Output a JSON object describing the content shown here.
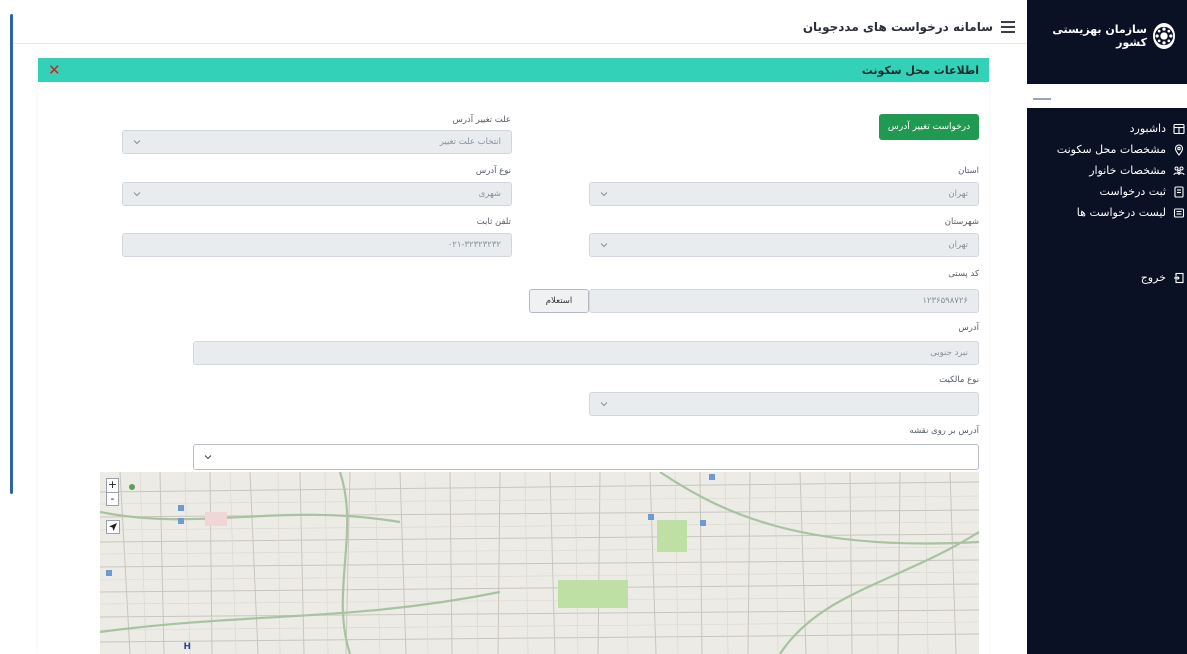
{
  "sidebar": {
    "brand": "سازمان بهزیستی کشور",
    "items": [
      {
        "label": "داشبورد",
        "icon": "dashboard-icon"
      },
      {
        "label": "مشخصات محل سکونت",
        "icon": "location-pin-icon"
      },
      {
        "label": "مشخصات خانوار",
        "icon": "family-icon"
      },
      {
        "label": "ثبت درخواست",
        "icon": "document-icon"
      },
      {
        "label": "لیست درخواست ها",
        "icon": "list-icon"
      }
    ],
    "logout": "خروج"
  },
  "header": {
    "title": "سامانه درخواست های مددجویان"
  },
  "panel": {
    "title": "اطلاعات محل سکونت",
    "close": "✕",
    "change_address_button": "درخواست تغییر آدرس",
    "change_reason": {
      "label": "علت تغییر آدرس",
      "placeholder": "انتخاب علت تغییر"
    },
    "province": {
      "label": "استان",
      "value": "تهران"
    },
    "address_type": {
      "label": "نوع آدرس",
      "value": "شهری"
    },
    "city": {
      "label": "شهرستان",
      "value": "تهران"
    },
    "landline": {
      "label": "تلفن ثابت",
      "value": "۰۲۱-۳۲۳۲۳۲۳۲"
    },
    "postal_code": {
      "label": "کد پستی",
      "value": "۱۲۳۶۵۹۸۷۲۶"
    },
    "inquiry_button": "استعلام",
    "address": {
      "label": "آدرس",
      "value": "نبرد جنوبی"
    },
    "ownership_type": {
      "label": "نوع مالکیت",
      "value": ""
    },
    "map_address": {
      "label": "آدرس بر روی نقشه",
      "value": ""
    }
  },
  "map": {
    "zoom_in": "+",
    "zoom_out": "-"
  },
  "colors": {
    "sidebar_bg": "#0b1124",
    "panel_header": "#33d1b8",
    "primary_button": "#1f9a50",
    "close": "#d41f1f"
  }
}
